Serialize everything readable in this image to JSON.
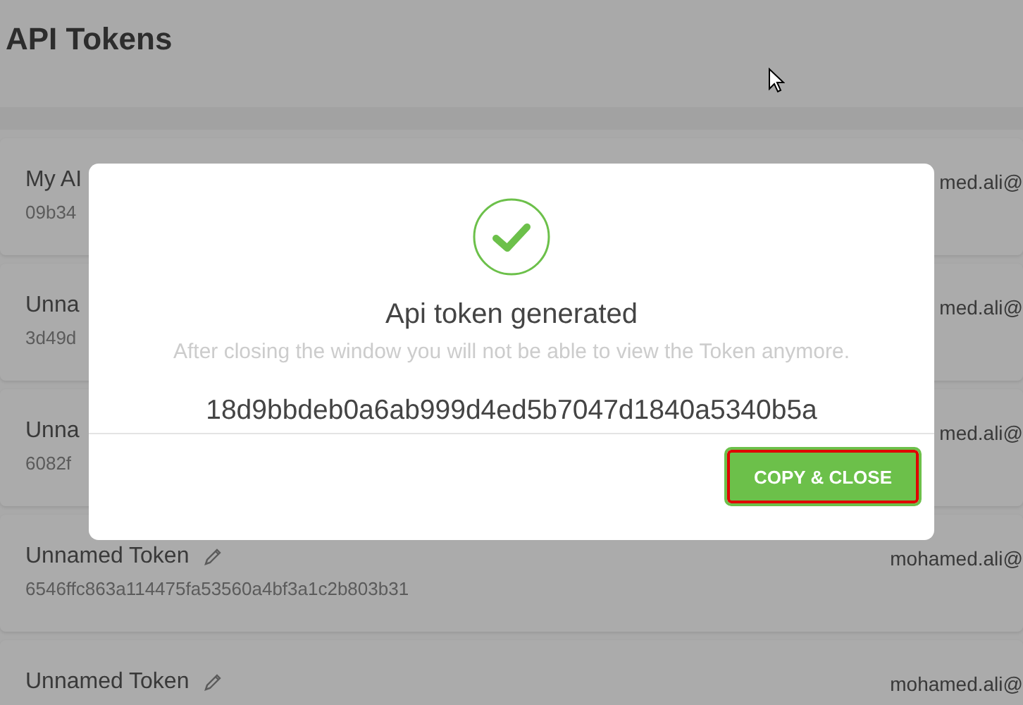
{
  "page": {
    "title": "API Tokens"
  },
  "tokens": [
    {
      "name": "My AI",
      "token": "09b34",
      "email": "med.ali@"
    },
    {
      "name": "Unna",
      "token": "3d49d",
      "email": "med.ali@"
    },
    {
      "name": "Unna",
      "token": "6082f",
      "email": "med.ali@"
    },
    {
      "name": "Unnamed Token",
      "token": "6546ffc863a114475fa53560a4bf3a1c2b803b31",
      "email": "mohamed.ali@",
      "edit_icon": true
    },
    {
      "name": "Unnamed Token",
      "email": "mohamed.ali@",
      "edit_icon": true
    }
  ],
  "modal": {
    "title": "Api token generated",
    "message": "After closing the window you will not be able to view the Token anymore.",
    "token": "18d9bbdeb0a6ab999d4ed5b7047d1840a5340b5a",
    "button": "COPY & CLOSE"
  }
}
